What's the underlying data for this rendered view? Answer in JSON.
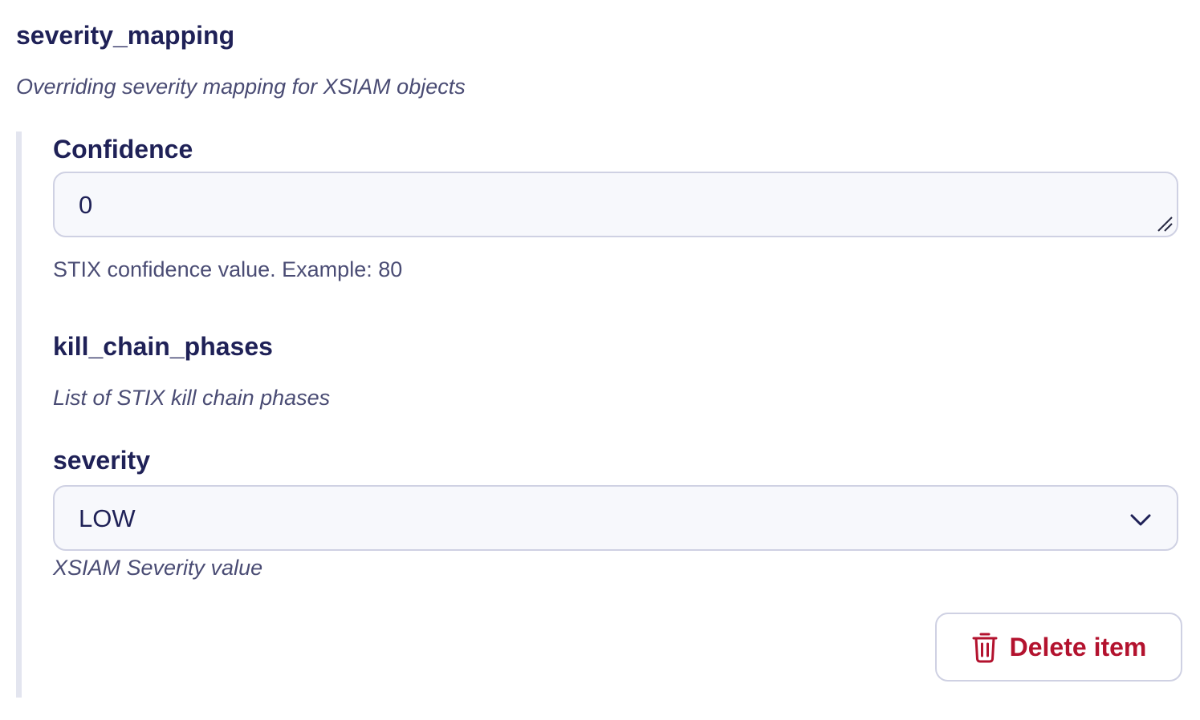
{
  "section": {
    "title": "severity_mapping",
    "description": "Overriding severity mapping for XSIAM objects"
  },
  "confidence": {
    "label": "Confidence",
    "value": "0",
    "help": "STIX confidence value. Example: 80"
  },
  "kill_chain_phases": {
    "label": "kill_chain_phases",
    "description": "List of STIX kill chain phases"
  },
  "severity": {
    "label": "severity",
    "selected": "LOW",
    "help": "XSIAM Severity value"
  },
  "actions": {
    "delete_label": "Delete item"
  },
  "colors": {
    "heading": "#1f2157",
    "muted": "#4a4c74",
    "danger": "#b3122e",
    "field_bg": "#f7f8fc",
    "border": "#cfd1e3",
    "group_rule": "#e3e5ef"
  },
  "icons": {
    "delete": "trash-icon",
    "select": "chevron-down-icon",
    "textarea": "resize-handle-icon"
  }
}
